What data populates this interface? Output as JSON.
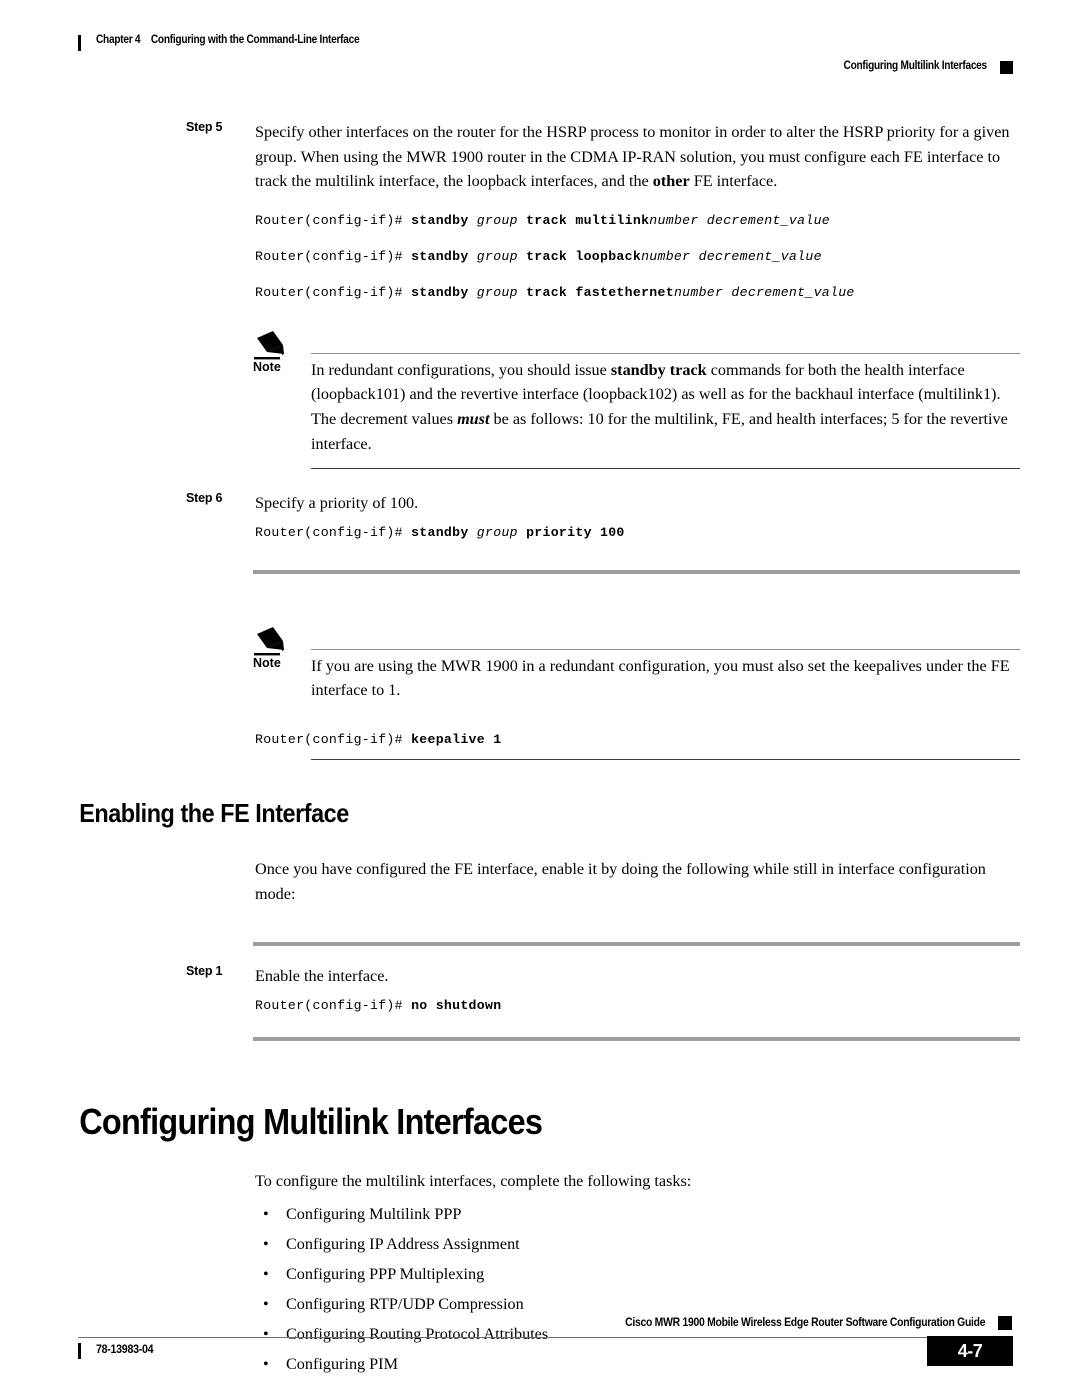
{
  "header": {
    "chapter_number": "Chapter 4",
    "chapter_title": "Configuring with the Command-Line Interface",
    "section_title": "Configuring Multilink Interfaces"
  },
  "steps": {
    "step5": {
      "label": "Step 5",
      "text_part1": "Specify other interfaces on the router for the HSRP process to monitor in order to alter the HSRP priority for a given group. When using the MWR 1900 router in the CDMA IP-RAN solution, you must configure each FE interface to track the multilink interface, the loopback interfaces, and the ",
      "emphasis": "other",
      "text_part2": " FE interface.",
      "code_lines": [
        {
          "prompt": "Router(config-if)# ",
          "cmd": "standby ",
          "arg1": "group ",
          "cmd2": "track multilink",
          "arg2": "number decrement_value"
        },
        {
          "prompt": "Router(config-if)# ",
          "cmd": "standby ",
          "arg1": "group ",
          "cmd2": "track loopback",
          "arg2": "number decrement_value"
        },
        {
          "prompt": "Router(config-if)# ",
          "cmd": "standby ",
          "arg1": "group ",
          "cmd2": "track fastethernet",
          "arg2": "number decrement_value"
        }
      ]
    },
    "step6": {
      "label": "Step 6",
      "text": "Specify a priority of 100.",
      "code": {
        "prompt": "Router(config-if)# ",
        "cmd": "standby ",
        "arg": "group ",
        "cmd2": "priority 100"
      }
    },
    "step1": {
      "label": "Step 1",
      "text": "Enable the interface.",
      "code": {
        "prompt": "Router(config-if)# ",
        "cmd": "no shutdown"
      }
    }
  },
  "note1": {
    "label": "Note",
    "icon": "pencil-icon",
    "text_part1": "In redundant configurations, you should issue ",
    "bold1": "standby track",
    "text_part2": " commands for both the health interface (loopback101) and the revertive interface (loopback102) as well as for the backhaul interface (multilink1). The decrement values ",
    "italic1": "must",
    "text_part3": " be as follows: 10 for the multilink, FE, and health interfaces; 5 for the revertive interface."
  },
  "note2": {
    "label": "Note",
    "icon": "pencil-icon",
    "text": "If you are using the MWR 1900 in a redundant configuration, you must also set the keepalives under the FE interface to 1.",
    "code": {
      "prompt": "Router(config-if)# ",
      "cmd": "keepalive 1"
    }
  },
  "section_heading": "Enabling the FE Interface",
  "section_intro": "Once you have configured the FE interface, enable it by doing the following while still in interface configuration mode:",
  "chapter_heading": "Configuring Multilink Interfaces",
  "chapter_intro": "To configure the multilink interfaces, complete the following tasks:",
  "task_list": [
    "Configuring Multilink PPP",
    "Configuring IP Address Assignment",
    "Configuring PPP Multiplexing",
    "Configuring RTP/UDP Compression",
    "Configuring Routing Protocol Attributes",
    "Configuring PIM"
  ],
  "bullet_glyph": "•",
  "footer": {
    "doc_title": "Cisco MWR 1900 Mobile Wireless Edge Router Software Configuration Guide",
    "doc_number": "78-13983-04",
    "page_number": "4-7"
  }
}
